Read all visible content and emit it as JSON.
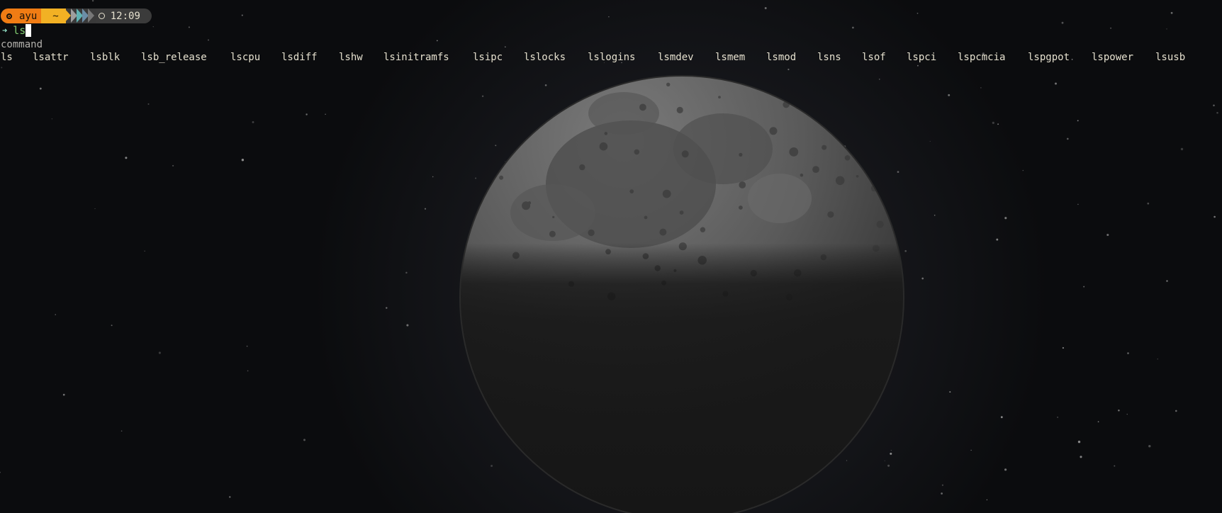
{
  "prompt": {
    "user": "ayu",
    "directory": "~",
    "time": "12:09",
    "icons": {
      "user": "circle-dot-icon",
      "time": "clock-icon",
      "arrow": "prompt-arrow-icon"
    },
    "colors": {
      "user_segment": "#f07c14",
      "dir_segment": "#f2b124",
      "time_segment": "#3b3b3b",
      "chevrons": [
        "#9e9e9e",
        "#5fb3b3",
        "#6c8ea8",
        "#777777"
      ]
    }
  },
  "input": {
    "typed": "ls",
    "arrow": "➜"
  },
  "completion": {
    "header": "command",
    "items": [
      "ls",
      "lsattr",
      "lsblk",
      "lsb_release",
      "lscpu",
      "lsdiff",
      "lshw",
      "lsinitramfs",
      "lsipc",
      "lslocks",
      "lslogins",
      "lsmdev",
      "lsmem",
      "lsmod",
      "lsns",
      "lsof",
      "lspci",
      "lspcmcia",
      "lspgpot",
      "lspower",
      "lsusb"
    ]
  },
  "wallpaper": {
    "subject": "moon-icon",
    "background_color": "#0b0c0e"
  }
}
